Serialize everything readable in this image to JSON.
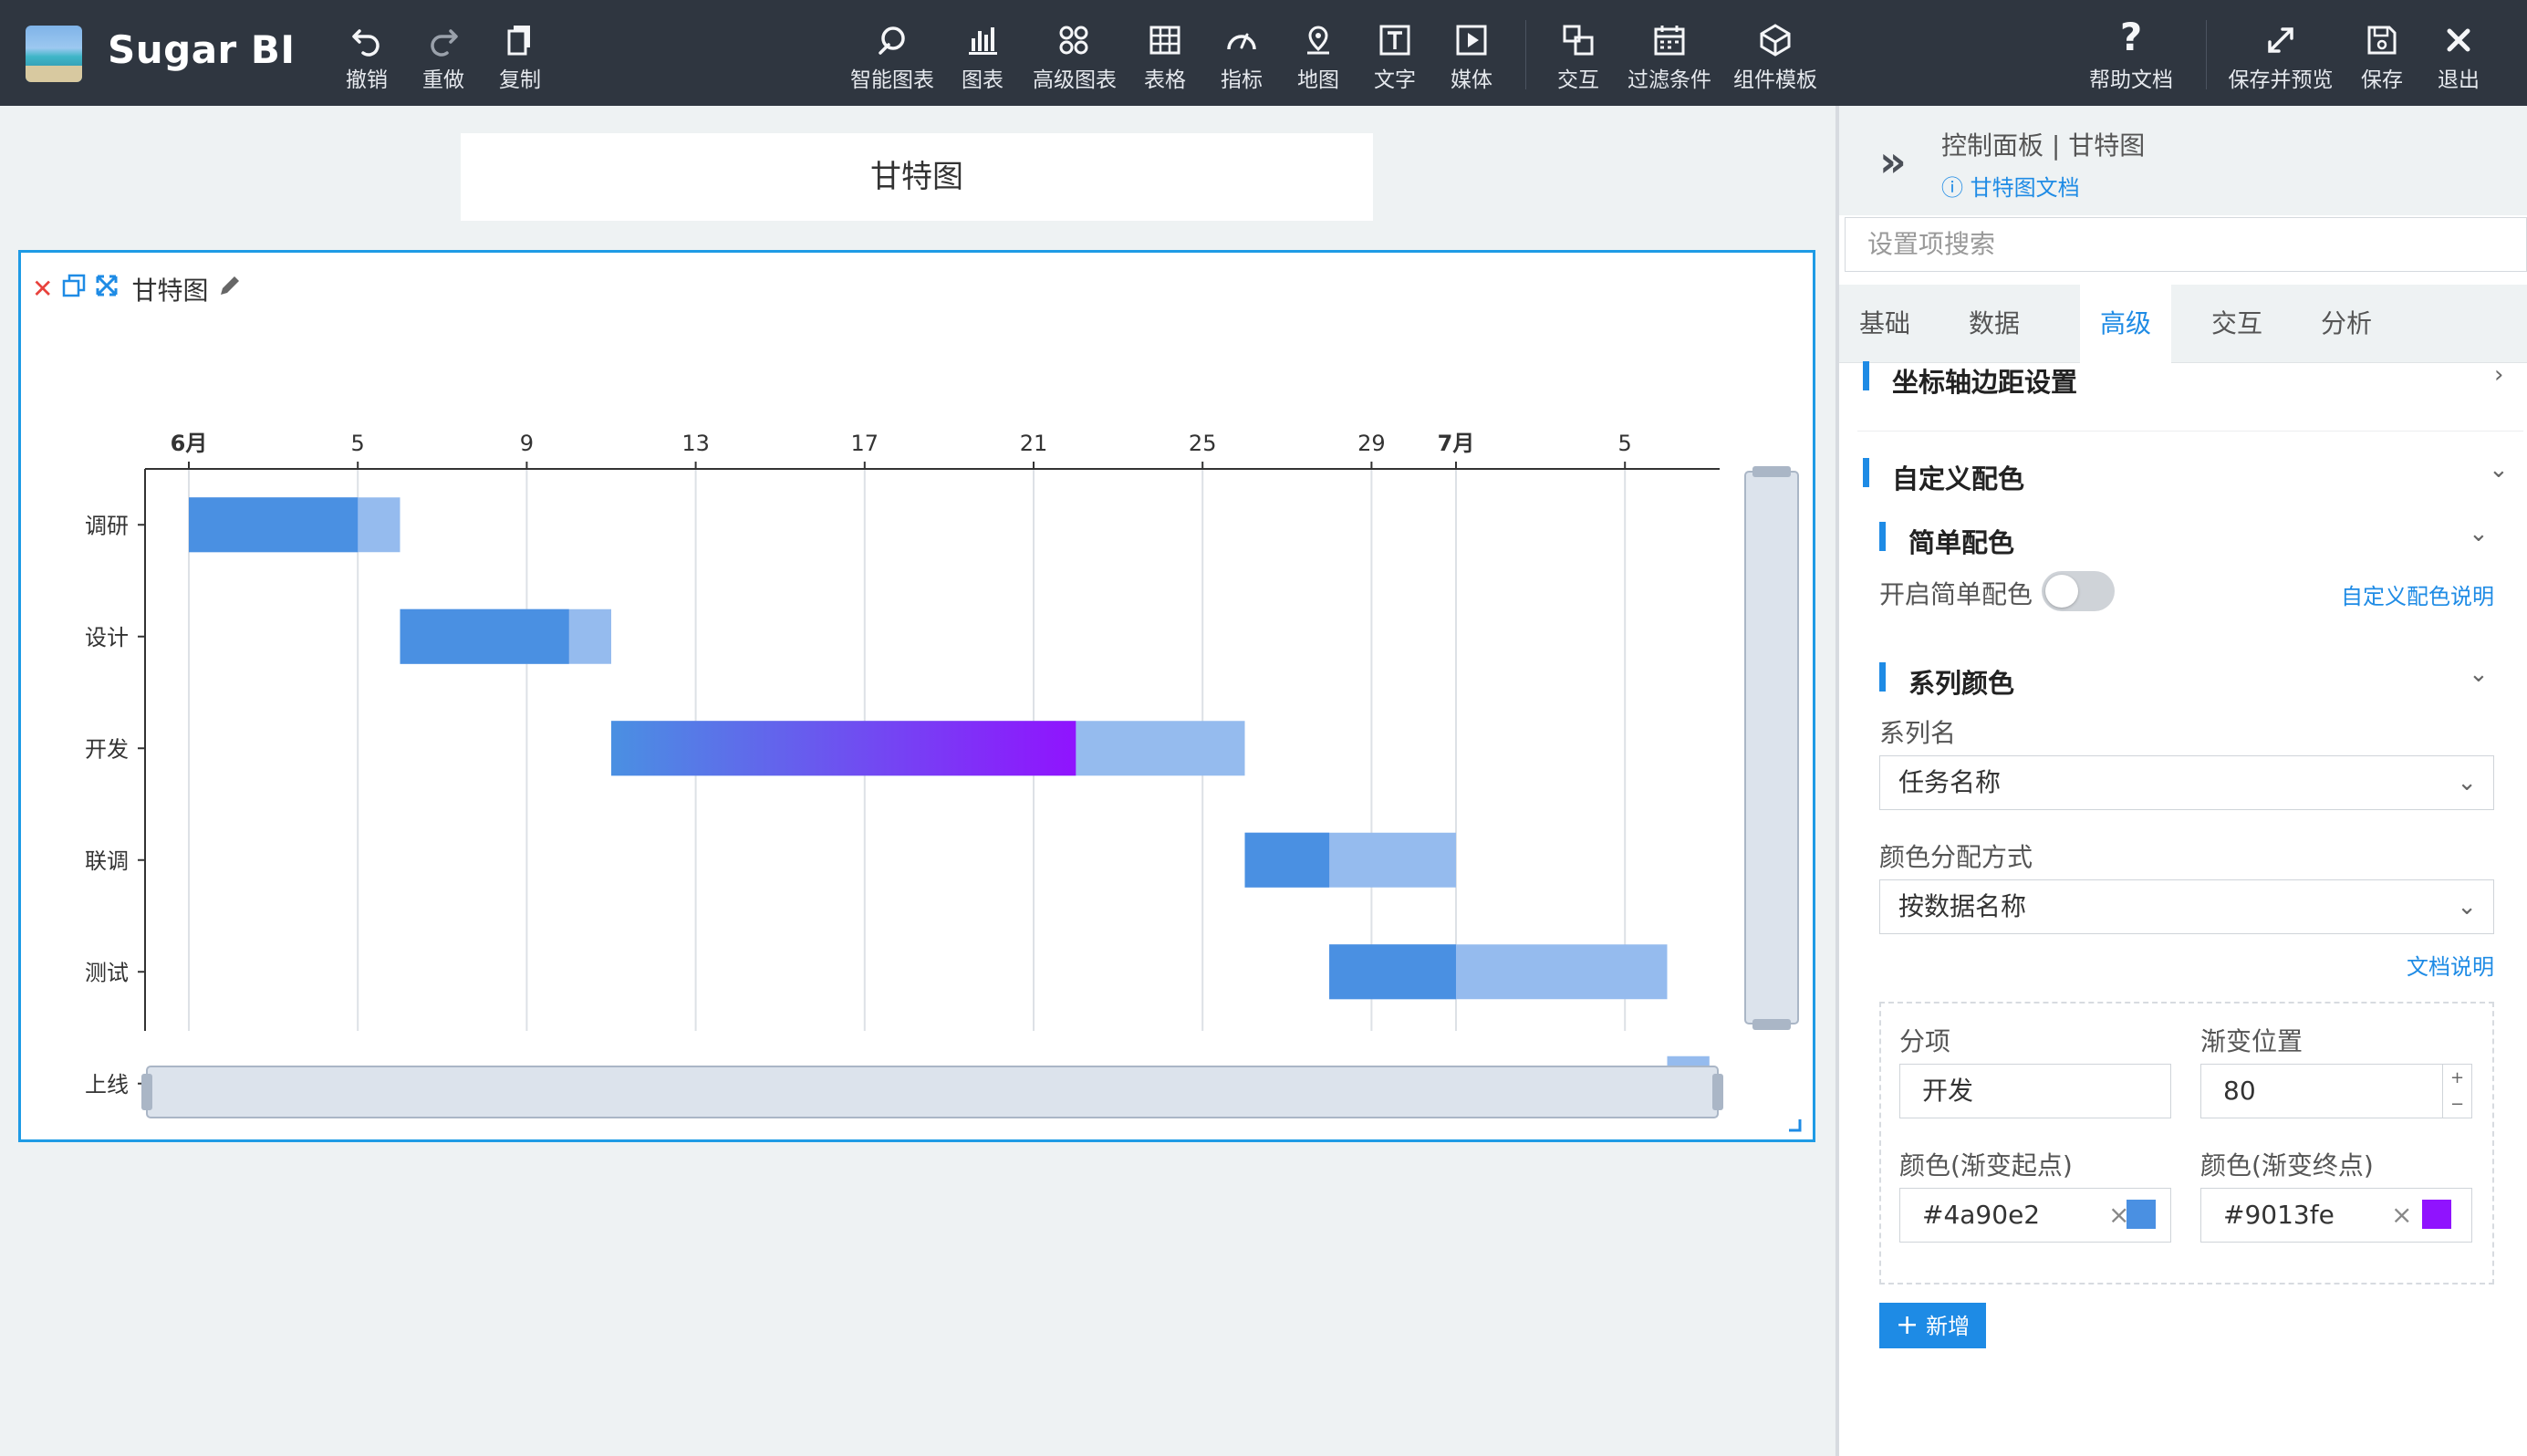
{
  "app": {
    "title": "Sugar BI"
  },
  "toolbar": {
    "left": [
      {
        "label": "撤销",
        "icon": "undo-icon"
      },
      {
        "label": "重做",
        "icon": "redo-icon"
      },
      {
        "label": "复制",
        "icon": "copy-icon"
      }
    ],
    "center": [
      {
        "label": "智能图表",
        "icon": "smart-chart-icon"
      },
      {
        "label": "图表",
        "icon": "bar-chart-icon"
      },
      {
        "label": "高级图表",
        "icon": "advanced-chart-icon"
      },
      {
        "label": "表格",
        "icon": "table-icon"
      },
      {
        "label": "指标",
        "icon": "gauge-icon"
      },
      {
        "label": "地图",
        "icon": "map-pin-icon"
      },
      {
        "label": "文字",
        "icon": "text-icon"
      },
      {
        "label": "媒体",
        "icon": "media-icon"
      },
      {
        "label": "交互",
        "icon": "interaction-icon"
      },
      {
        "label": "过滤条件",
        "icon": "filter-calendar-icon"
      },
      {
        "label": "组件模板",
        "icon": "component-template-icon"
      }
    ],
    "right": [
      {
        "label": "帮助文档",
        "icon": "help-icon"
      },
      {
        "label": "保存并预览",
        "icon": "expand-arrows-icon"
      },
      {
        "label": "保存",
        "icon": "save-icon"
      },
      {
        "label": "退出",
        "icon": "close-icon"
      }
    ]
  },
  "canvas": {
    "title_card": "甘特图",
    "widget": {
      "title": "甘特图"
    }
  },
  "chart_data": {
    "type": "gantt",
    "x_tick_labels": [
      "6月",
      "5",
      "9",
      "13",
      "17",
      "21",
      "25",
      "29",
      "7月",
      "5"
    ],
    "xlim": [
      "2024-06-01",
      "2024-07-07"
    ],
    "categories": [
      "调研",
      "设计",
      "开发",
      "联调",
      "测试",
      "上线"
    ],
    "tasks": [
      {
        "name": "调研",
        "start": "2024-06-01",
        "progress_end": "2024-06-05",
        "end": "2024-06-06"
      },
      {
        "name": "设计",
        "start": "2024-06-06",
        "progress_end": "2024-06-10",
        "end": "2024-06-11"
      },
      {
        "name": "开发",
        "start": "2024-06-11",
        "progress_end": "2024-06-22",
        "end": "2024-06-26"
      },
      {
        "name": "联调",
        "start": "2024-06-26",
        "progress_end": "2024-06-28",
        "end": "2024-07-01"
      },
      {
        "name": "测试",
        "start": "2024-06-28",
        "progress_end": "2024-07-01",
        "end": "2024-07-06"
      },
      {
        "name": "上线",
        "start": "2024-07-06",
        "progress_end": "2024-07-06",
        "end": "2024-07-07"
      }
    ],
    "colors": {
      "progress": "#4a90e2",
      "remaining": "#95bbee",
      "gradient_start": "#4a90e2",
      "gradient_end": "#9013fe",
      "gridline": "#dde1e6"
    },
    "gradient_task": "开发"
  },
  "panel": {
    "breadcrumb": "控制面板 | 甘特图",
    "doc_link": "甘特图文档",
    "search_placeholder": "设置项搜索",
    "tabs": [
      "基础",
      "数据",
      "高级",
      "交互",
      "分析"
    ],
    "active_tab": "高级",
    "sections": {
      "axis_margin": "坐标轴边距设置",
      "custom_color": "自定义配色",
      "simple_color": "简单配色",
      "enable_simple_color": "开启简单配色",
      "custom_color_help": "自定义配色说明",
      "series_color": "系列颜色",
      "series_name_label": "系列名",
      "series_name_value": "任务名称",
      "color_method_label": "颜色分配方式",
      "color_method_value": "按数据名称",
      "doc_help": "文档说明"
    },
    "item_card": {
      "item_label": "分项",
      "item_value": "开发",
      "gradient_pos_label": "渐变位置",
      "gradient_pos_value": "80",
      "color_start_label": "颜色(渐变起点)",
      "color_start_value": "#4a90e2",
      "color_end_label": "颜色(渐变终点)",
      "color_end_value": "#9013fe"
    },
    "add_button": "新增"
  }
}
